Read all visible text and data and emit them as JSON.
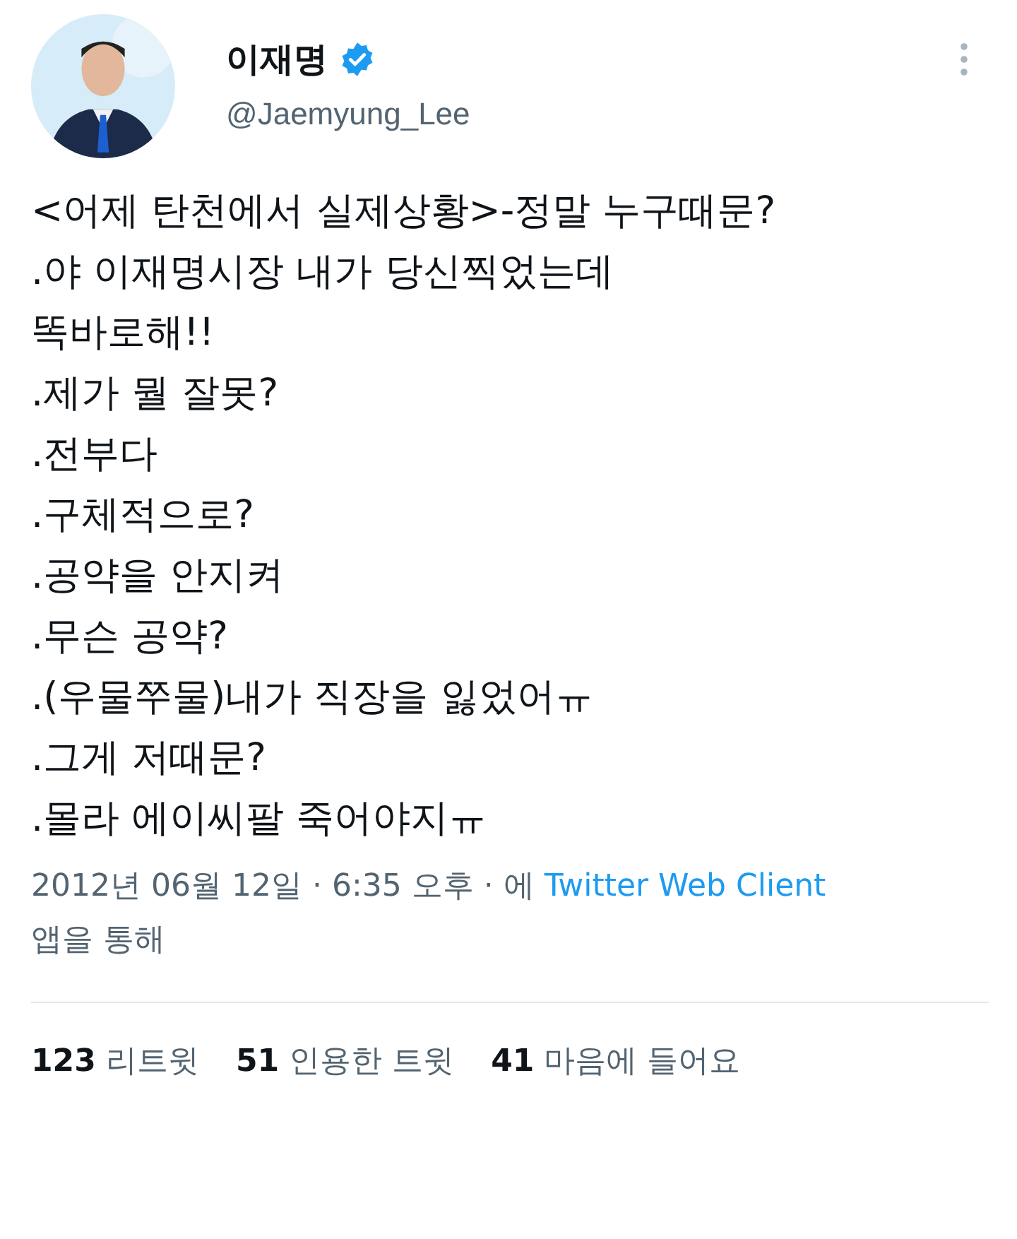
{
  "author": {
    "name": "이재명",
    "verified": true,
    "handle": "@Jaemyung_Lee"
  },
  "tweet_lines": [
    "<어제 탄천에서 실제상황>-정말 누구때문?",
    ".야 이재명시장 내가 당신찍었는데",
    "똑바로해!!",
    ".제가 뭘 잘못?",
    ".전부다",
    ".구체적으로?",
    ".공약을 안지켜",
    ".무슨 공약?",
    ".(우물쭈물)내가 직장을 잃었어ㅠ",
    ".그게 저때문?",
    ".몰라 에이씨팔 죽어야지ㅠ"
  ],
  "meta": {
    "date": "2012년 06월 12일",
    "separator_1": "·",
    "time": "6:35 오후",
    "separator_2": "·",
    "via_prefix": "에",
    "client": "Twitter Web Client",
    "via_suffix": "앱을 통해"
  },
  "stats": [
    {
      "count": "123",
      "label": "리트윗"
    },
    {
      "count": "51",
      "label": "인용한 트윗"
    },
    {
      "count": "41",
      "label": "마음에 들어요"
    }
  ]
}
